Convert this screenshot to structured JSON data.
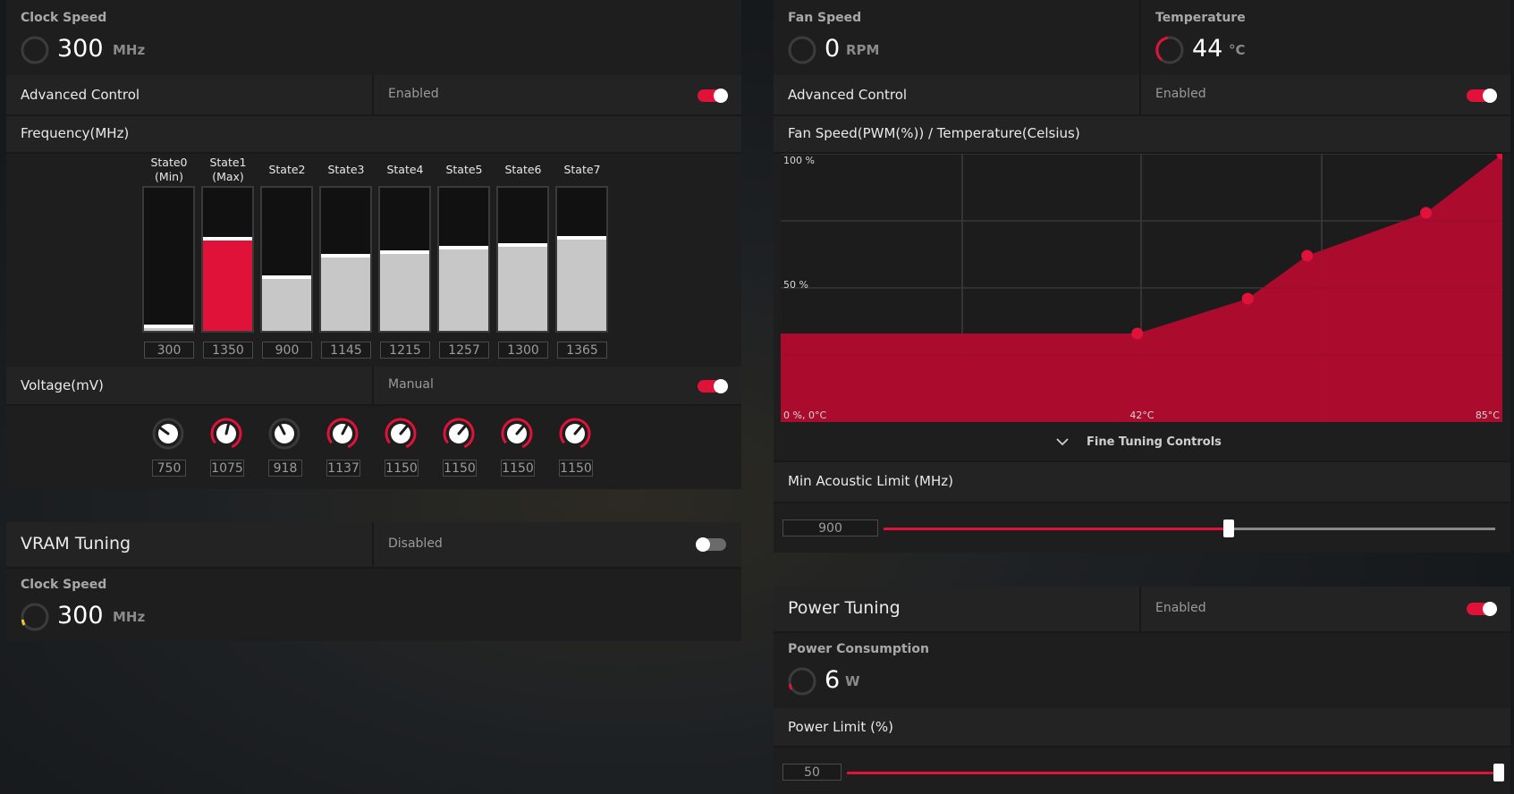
{
  "gpu": {
    "clock_speed": {
      "caption": "Clock Speed",
      "value": "300",
      "unit": "MHz"
    },
    "advanced_control": {
      "label": "Advanced Control",
      "status": "Enabled",
      "enabled": true
    },
    "frequency_title": "Frequency(MHz)",
    "states": [
      {
        "label": "State0\n(Min)",
        "value": "300",
        "level": 0.02
      },
      {
        "label": "State1\n(Max)",
        "value": "1350",
        "level": 0.63,
        "selected": true
      },
      {
        "label": "State2",
        "value": "900",
        "level": 0.36
      },
      {
        "label": "State3",
        "value": "1145",
        "level": 0.51
      },
      {
        "label": "State4",
        "value": "1215",
        "level": 0.54
      },
      {
        "label": "State5",
        "value": "1257",
        "level": 0.57
      },
      {
        "label": "State6",
        "value": "1300",
        "level": 0.59
      },
      {
        "label": "State7",
        "value": "1365",
        "level": 0.64
      }
    ],
    "voltage": {
      "label": "Voltage(mV)",
      "mode": "Manual",
      "enabled": true,
      "values": [
        "750",
        "1075",
        "918",
        "1137",
        "1150",
        "1150",
        "1150",
        "1150"
      ],
      "knob_types": [
        "dim",
        "red",
        "dim",
        "red",
        "red",
        "red",
        "red",
        "red"
      ],
      "knob_levels": [
        0.3,
        0.55,
        0.4,
        0.6,
        0.65,
        0.65,
        0.65,
        0.65
      ]
    }
  },
  "vram": {
    "title": "VRAM Tuning",
    "status": "Disabled",
    "enabled": false,
    "clock_speed": {
      "caption": "Clock Speed",
      "value": "300",
      "unit": "MHz"
    }
  },
  "fan": {
    "fan_speed": {
      "caption": "Fan Speed",
      "value": "0",
      "unit": "RPM"
    },
    "temperature": {
      "caption": "Temperature",
      "value": "44",
      "unit": "°C"
    },
    "advanced_control": {
      "label": "Advanced Control",
      "status": "Enabled",
      "enabled": true
    },
    "curve_title": "Fan Speed(PWM(%)) / Temperature(Celsius)",
    "fine_tuning": "Fine Tuning Controls",
    "min_acoustic": {
      "label": "Min Acoustic Limit (MHz)",
      "value": "900",
      "fraction": 0.565
    }
  },
  "chart_data": {
    "type": "area",
    "title": "Fan Speed(PWM(%)) / Temperature(Celsius)",
    "tick_labels": {
      "y_top": "100 %",
      "y_mid": "50 %",
      "origin": "0 %, 0°C",
      "x_mid": "42°C",
      "x_max": "85°C"
    },
    "xlim": [
      0,
      85
    ],
    "ylim": [
      0,
      100
    ],
    "grid": true,
    "points": [
      {
        "x": 0,
        "y": 33
      },
      {
        "x": 42,
        "y": 33
      },
      {
        "x": 55,
        "y": 46
      },
      {
        "x": 62,
        "y": 62
      },
      {
        "x": 76,
        "y": 78
      },
      {
        "x": 85,
        "y": 100
      }
    ],
    "marked_points": [
      {
        "x": 42,
        "y": 33
      },
      {
        "x": 55,
        "y": 46
      },
      {
        "x": 62,
        "y": 62
      },
      {
        "x": 76,
        "y": 78
      },
      {
        "x": 85,
        "y": 100
      }
    ],
    "fill_color": "#b30b2e",
    "marker_color": "#e0123a"
  },
  "power": {
    "title": "Power Tuning",
    "status": "Enabled",
    "enabled": true,
    "consumption": {
      "caption": "Power Consumption",
      "value": "6",
      "unit": "W"
    },
    "limit": {
      "label": "Power Limit (%)",
      "value": "50",
      "fraction": 1.0
    }
  },
  "colors": {
    "accent": "#e0123a",
    "panel": "#1e1e1e",
    "row": "#232323"
  }
}
